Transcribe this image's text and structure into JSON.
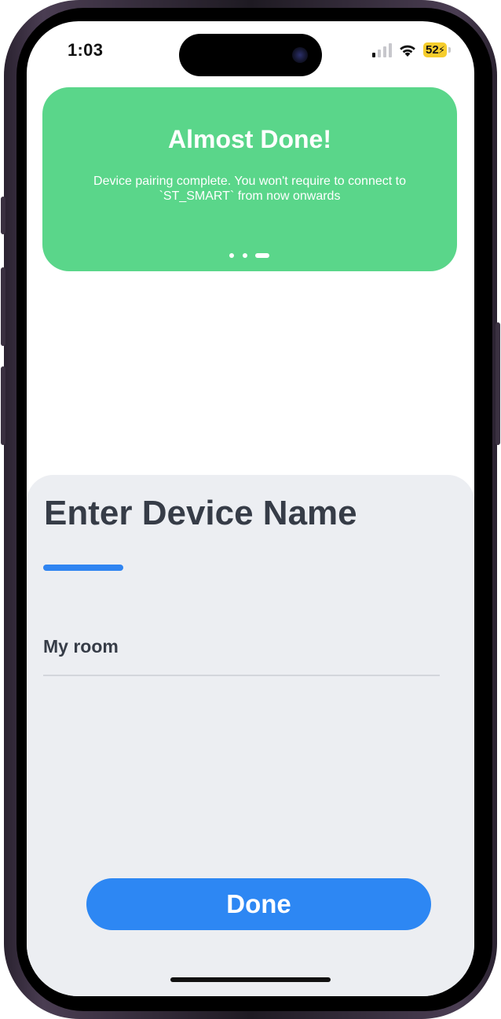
{
  "status_bar": {
    "time": "1:03",
    "battery_level": "52",
    "battery_color": "#f6cd2c",
    "icons": [
      "signal-icon",
      "wifi-icon",
      "battery-icon",
      "charging-bolt-icon"
    ]
  },
  "banner": {
    "title": "Almost Done!",
    "message": "Device pairing complete. You won't require to connect to `ST_SMART` from now onwards",
    "background_color": "#5ad68a",
    "page_count": 3,
    "active_page": 3
  },
  "form": {
    "title": "Enter Device Name",
    "device_name_value": "My room",
    "accent_color": "#2f84f1"
  },
  "actions": {
    "done_label": "Done",
    "button_color": "#2d87f3"
  }
}
